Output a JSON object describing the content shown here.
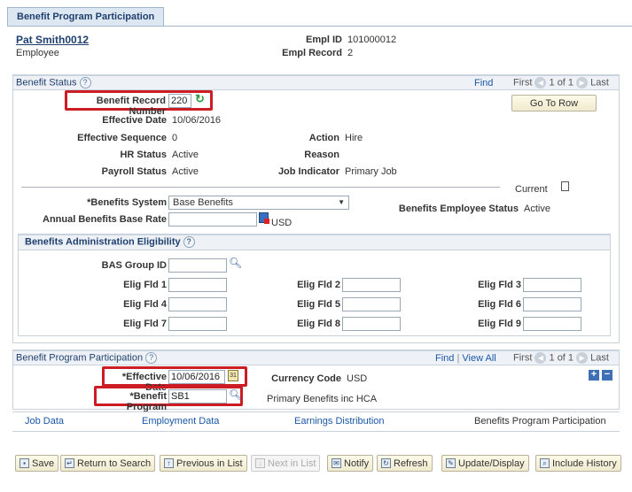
{
  "tab": {
    "label": "Benefit Program Participation"
  },
  "employee": {
    "name": "Pat Smith0012",
    "type": "Employee",
    "empl_id_label": "Empl ID",
    "empl_id": "101000012",
    "empl_record_label": "Empl Record",
    "empl_record": "2"
  },
  "benefit_status": {
    "title": "Benefit Status",
    "find": "Find",
    "first": "First",
    "count": "1 of 1",
    "last": "Last",
    "go_to_row": "Go To Row",
    "record_number_label": "Benefit Record Number",
    "record_number": "220",
    "effective_date_label": "Effective Date",
    "effective_date": "10/06/2016",
    "effective_sequence_label": "Effective Sequence",
    "effective_sequence": "0",
    "action_label": "Action",
    "action": "Hire",
    "hr_status_label": "HR Status",
    "hr_status": "Active",
    "reason_label": "Reason",
    "reason": "",
    "payroll_status_label": "Payroll Status",
    "payroll_status": "Active",
    "job_indicator_label": "Job Indicator",
    "job_indicator": "Primary Job",
    "current": "Current",
    "benefits_system_label": "*Benefits System",
    "benefits_system": "Base Benefits",
    "annual_rate_label": "Annual Benefits Base Rate",
    "annual_rate": "",
    "currency": "USD",
    "emp_status_label": "Benefits Employee Status",
    "emp_status": "Active"
  },
  "eligibility": {
    "title": "Benefits Administration Eligibility",
    "bas_group_label": "BAS Group ID",
    "fields": [
      "Elig Fld 1",
      "Elig Fld 2",
      "Elig Fld 3",
      "Elig Fld 4",
      "Elig Fld 5",
      "Elig Fld 6",
      "Elig Fld 7",
      "Elig Fld 8",
      "Elig Fld 9"
    ]
  },
  "participation": {
    "title": "Benefit Program Participation",
    "find": "Find",
    "view_all": "View All",
    "first": "First",
    "count": "1 of 1",
    "last": "Last",
    "effective_date_label": "*Effective Date",
    "effective_date": "10/06/2016",
    "currency_code_label": "Currency Code",
    "currency_code": "USD",
    "program_label": "*Benefit Program",
    "program": "SB1",
    "program_desc": "Primary Benefits inc HCA"
  },
  "bottom_links": [
    "Job Data",
    "Employment Data",
    "Earnings Distribution",
    "Benefits Program Participation"
  ],
  "toolbar": {
    "save": "Save",
    "return_to_search": "Return to Search",
    "previous_in_list": "Previous in List",
    "next_in_list": "Next in List",
    "notify": "Notify",
    "refresh": "Refresh",
    "update_display": "Update/Display",
    "include_history": "Include History"
  }
}
